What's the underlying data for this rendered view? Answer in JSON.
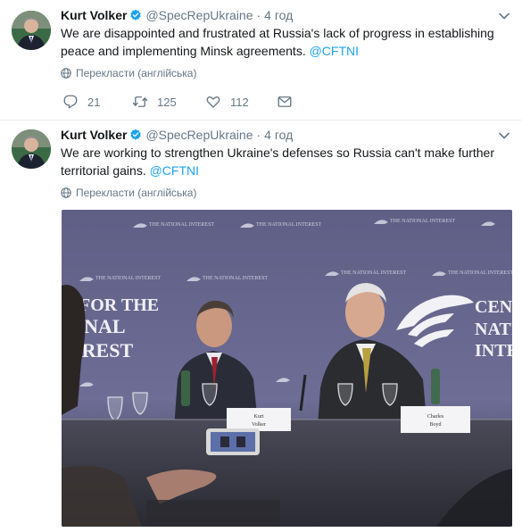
{
  "tweets": [
    {
      "author_name": "Kurt Volker",
      "handle": "@SpecRepUkraine",
      "separator": "·",
      "time": "4 год",
      "text": "We are disappointed and frustrated at Russia's lack of progress in establishing peace and implementing Minsk agreements.",
      "hashtag": "@CFTNI",
      "translate_label": "Перекласти (англійська)",
      "reply_count": "21",
      "retweet_count": "125",
      "like_count": "112"
    },
    {
      "author_name": "Kurt Volker",
      "handle": "@SpecRepUkraine",
      "separator": "·",
      "time": "4 год",
      "text": "We are working to strengthen Ukraine's defenses so Russia can't make further territorial gains.",
      "hashtag": "@CFTNI",
      "translate_label": "Перекласти (англійська)",
      "photo": {
        "backdrop_top_text": "THE NATIONAL INTEREST",
        "backdrop_large_text_1": "FOR THE",
        "backdrop_large_text_2": "ONAL",
        "backdrop_large_text_3": "EREST",
        "backdrop_right_text_1": "CENT",
        "backdrop_right_text_2": "NATI",
        "backdrop_right_text_3": "INTE",
        "nameplate_1_line_1": "Kurt",
        "nameplate_1_line_2": "Volker",
        "nameplate_2_line_1": "Charles",
        "nameplate_2_line_2": "Boyd"
      }
    }
  ],
  "colors": {
    "link": "#1da1f2",
    "muted": "#657786",
    "verified": "#1da1f2",
    "backdrop": "#6f6f93"
  },
  "icons": [
    "verified-badge-icon",
    "chevron-down-icon",
    "globe-icon",
    "reply-icon",
    "retweet-icon",
    "like-icon",
    "direct-message-icon"
  ]
}
